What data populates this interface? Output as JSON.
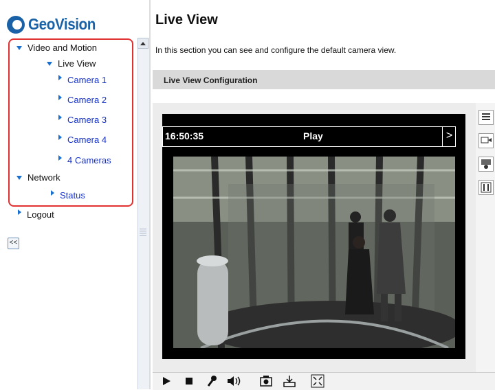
{
  "brand": {
    "name": "GeoVision",
    "color": "#1a62a8"
  },
  "sidebar": {
    "items": [
      {
        "label": "Video and Motion",
        "level": 0,
        "expanded": true
      },
      {
        "label": "Live View",
        "level": 1,
        "expanded": true
      },
      {
        "label": "Camera 1",
        "level": 2
      },
      {
        "label": "Camera 2",
        "level": 2
      },
      {
        "label": "Camera 3",
        "level": 2
      },
      {
        "label": "Camera 4",
        "level": 2
      },
      {
        "label": "4 Cameras",
        "level": 2
      },
      {
        "label": "Network",
        "level": 0,
        "expanded": true
      },
      {
        "label": "Status",
        "level": 1
      },
      {
        "label": "Logout",
        "level": 0
      }
    ],
    "collapse_label": "<<",
    "highlight_color": "#e03030"
  },
  "main": {
    "title": "Live View",
    "description": "In this section you can see and configure the default camera view.",
    "section_title": "Live View Configuration"
  },
  "viewer": {
    "time": "16:50:35",
    "status": "Play",
    "next_label": ">",
    "side_tools": [
      "menu-icon",
      "camera-switch-icon",
      "ptz-camera-icon",
      "io-panel-icon"
    ],
    "toolbar": [
      "play-icon",
      "stop-icon",
      "microphone-icon",
      "speaker-icon",
      "snapshot-icon",
      "download-icon",
      "fullscreen-icon"
    ]
  }
}
